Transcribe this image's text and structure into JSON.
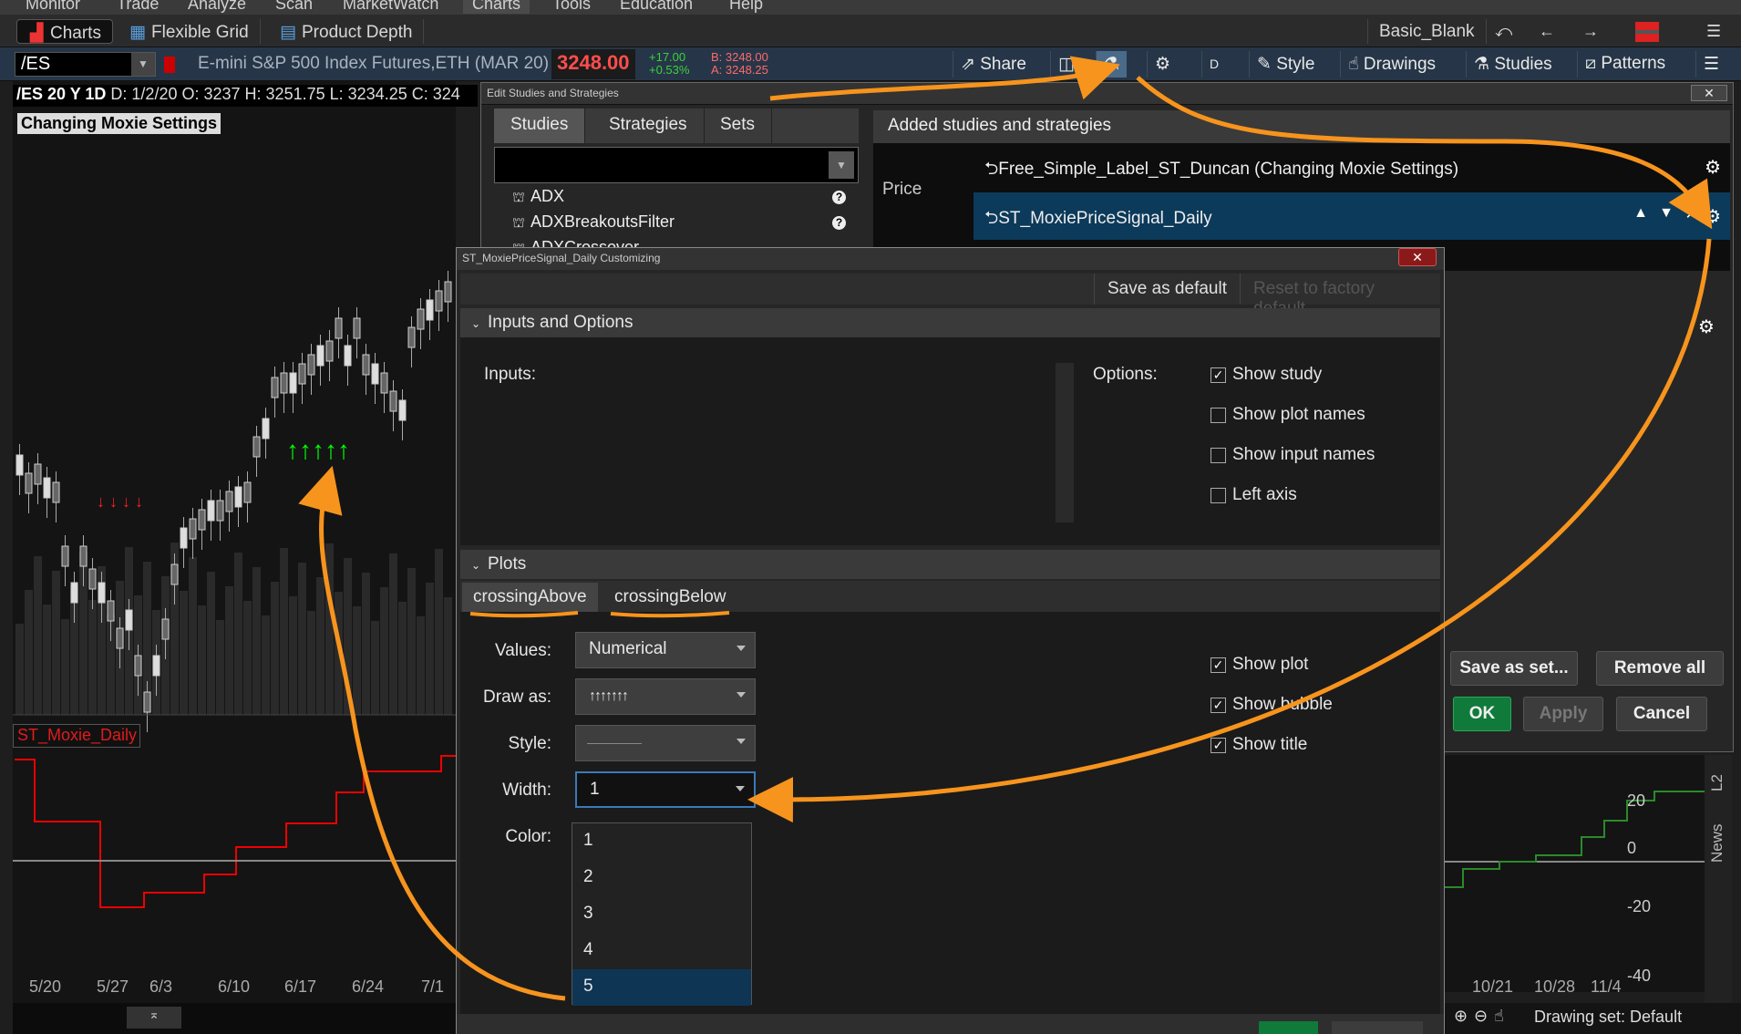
{
  "menu": [
    "Monitor",
    "Trade",
    "Analyze",
    "Scan",
    "MarketWatch",
    "Charts",
    "Tools",
    "Education",
    "Help"
  ],
  "page_tabs": {
    "charts": "Charts",
    "flexible_grid": "Flexible Grid",
    "product_depth": "Product Depth",
    "layout": "Basic_Blank"
  },
  "toolbar": {
    "symbol": "/ES",
    "description": "E-mini S&P 500 Index Futures,ETH (MAR 20)",
    "price": "3248.00",
    "change": "+17.00",
    "change_pct": "+0.53%",
    "bid": "B: 3248.00",
    "ask": "A: 3248.25",
    "share": "Share",
    "period": "D",
    "style": "Style",
    "drawings": "Drawings",
    "studies": "Studies",
    "patterns": "Patterns"
  },
  "chart": {
    "symbol_period": "/ES 20 Y 1D",
    "date": "D: 1/2/20",
    "open": "O: 3237",
    "high": "H: 3251.75",
    "low": "L: 3234.25",
    "close": "C: 324",
    "label": "Changing Moxie Settings",
    "lower_label": "ST_Moxie_Daily",
    "dates": [
      "5/20",
      "5/27",
      "6/3",
      "6/10",
      "6/17",
      "6/24",
      "7/1"
    ],
    "right_dates": [
      "10/21",
      "10/28",
      "11/4"
    ],
    "right_axis": [
      "20",
      "0",
      "-20",
      "-40"
    ],
    "drawing_set": "Drawing set: Default",
    "side_tabs": [
      "L2",
      "News"
    ]
  },
  "edit_window": {
    "title": "Edit Studies and Strategies",
    "tabs": [
      "Studies",
      "Strategies",
      "Sets"
    ],
    "studies": [
      "ADX",
      "ADXBreakoutsFilter",
      "ADXCrossover"
    ],
    "added_header": "Added studies and strategies",
    "price_label": "Price",
    "added": [
      "Free_Simple_Label_ST_Duncan (Changing Moxie Settings)",
      "ST_MoxiePriceSignal_Daily"
    ],
    "save_as_set": "Save as set...",
    "remove_all": "Remove all",
    "ok": "OK",
    "apply": "Apply",
    "cancel": "Cancel"
  },
  "customize": {
    "title": "ST_MoxiePriceSignal_Daily Customizing",
    "save_default": "Save as default",
    "reset_default": "Reset to factory default",
    "inputs_section": "Inputs and Options",
    "inputs_label": "Inputs:",
    "options_label": "Options:",
    "options": [
      {
        "label": "Show study",
        "checked": true
      },
      {
        "label": "Show plot names",
        "checked": false
      },
      {
        "label": "Show input names",
        "checked": false
      },
      {
        "label": "Left axis",
        "checked": false
      }
    ],
    "plots_section": "Plots",
    "plot_tabs": [
      "crossingAbove",
      "crossingBelow"
    ],
    "values_label": "Values:",
    "values_value": "Numerical",
    "draw_as_label": "Draw as:",
    "style_label": "Style:",
    "width_label": "Width:",
    "width_value": "1",
    "color_label": "Color:",
    "width_options": [
      "1",
      "2",
      "3",
      "4",
      "5"
    ],
    "selected_width_option": "5",
    "plot_options": [
      {
        "label": "Show plot",
        "checked": true
      },
      {
        "label": "Show bubble",
        "checked": true
      },
      {
        "label": "Show title",
        "checked": true
      }
    ]
  },
  "colors": {
    "accent_orange": "#f7941d",
    "up_arrow": "#00ff00",
    "down_arrow": "#ff2020",
    "ok_green": "#0f7a3a"
  }
}
